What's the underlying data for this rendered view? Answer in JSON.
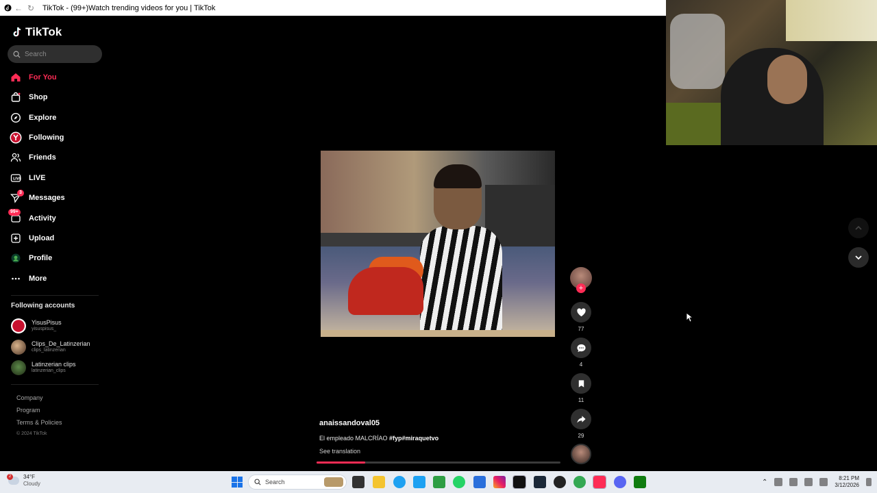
{
  "browser": {
    "tab_title": "TikTok - (99+)Watch trending videos for you | TikTok"
  },
  "sidebar": {
    "logo_text": "TikTok",
    "search_placeholder": "Search",
    "items": [
      {
        "label": "For You",
        "icon": "home-icon",
        "active": true
      },
      {
        "label": "Shop",
        "icon": "shopping-bag-icon"
      },
      {
        "label": "Explore",
        "icon": "compass-icon"
      },
      {
        "label": "Following",
        "icon": "following-avatar-icon"
      },
      {
        "label": "Friends",
        "icon": "friends-icon"
      },
      {
        "label": "LIVE",
        "icon": "live-icon"
      },
      {
        "label": "Messages",
        "icon": "paper-plane-icon",
        "badge": "3"
      },
      {
        "label": "Activity",
        "icon": "inbox-icon",
        "badge": "99+"
      },
      {
        "label": "Upload",
        "icon": "upload-icon"
      },
      {
        "label": "Profile",
        "icon": "profile-avatar-icon"
      },
      {
        "label": "More",
        "icon": "more-dots-icon"
      }
    ],
    "following_title": "Following accounts",
    "following": [
      {
        "name": "YisusPisus",
        "handle": "yisuspisus_"
      },
      {
        "name": "Clips_De_Latinzerian",
        "handle": "clips_latinzerian"
      },
      {
        "name": "Latinzerian clips",
        "handle": "latinzerian_clips"
      }
    ],
    "footer": {
      "company": "Company",
      "program": "Program",
      "terms": "Terms & Policies",
      "copyright": "© 2024 TikTok"
    }
  },
  "video": {
    "author": "anaissandoval05",
    "description_text": "El empleado MALCRÍAO ",
    "hashtags": "#fyp#miraquetvo",
    "see_translation": "See translation",
    "progress": 0.2
  },
  "actions": {
    "likes": "77",
    "comments": "4",
    "saves": "11",
    "shares": "29"
  },
  "taskbar": {
    "weather_badge": "2",
    "temperature": "34°F",
    "condition": "Cloudy",
    "search_label": "Search",
    "time": "8:21 PM",
    "date": "3/12/2026"
  },
  "colors": {
    "accent": "#fe2c55",
    "background": "#000000",
    "taskbar": "#e8ecf2"
  }
}
